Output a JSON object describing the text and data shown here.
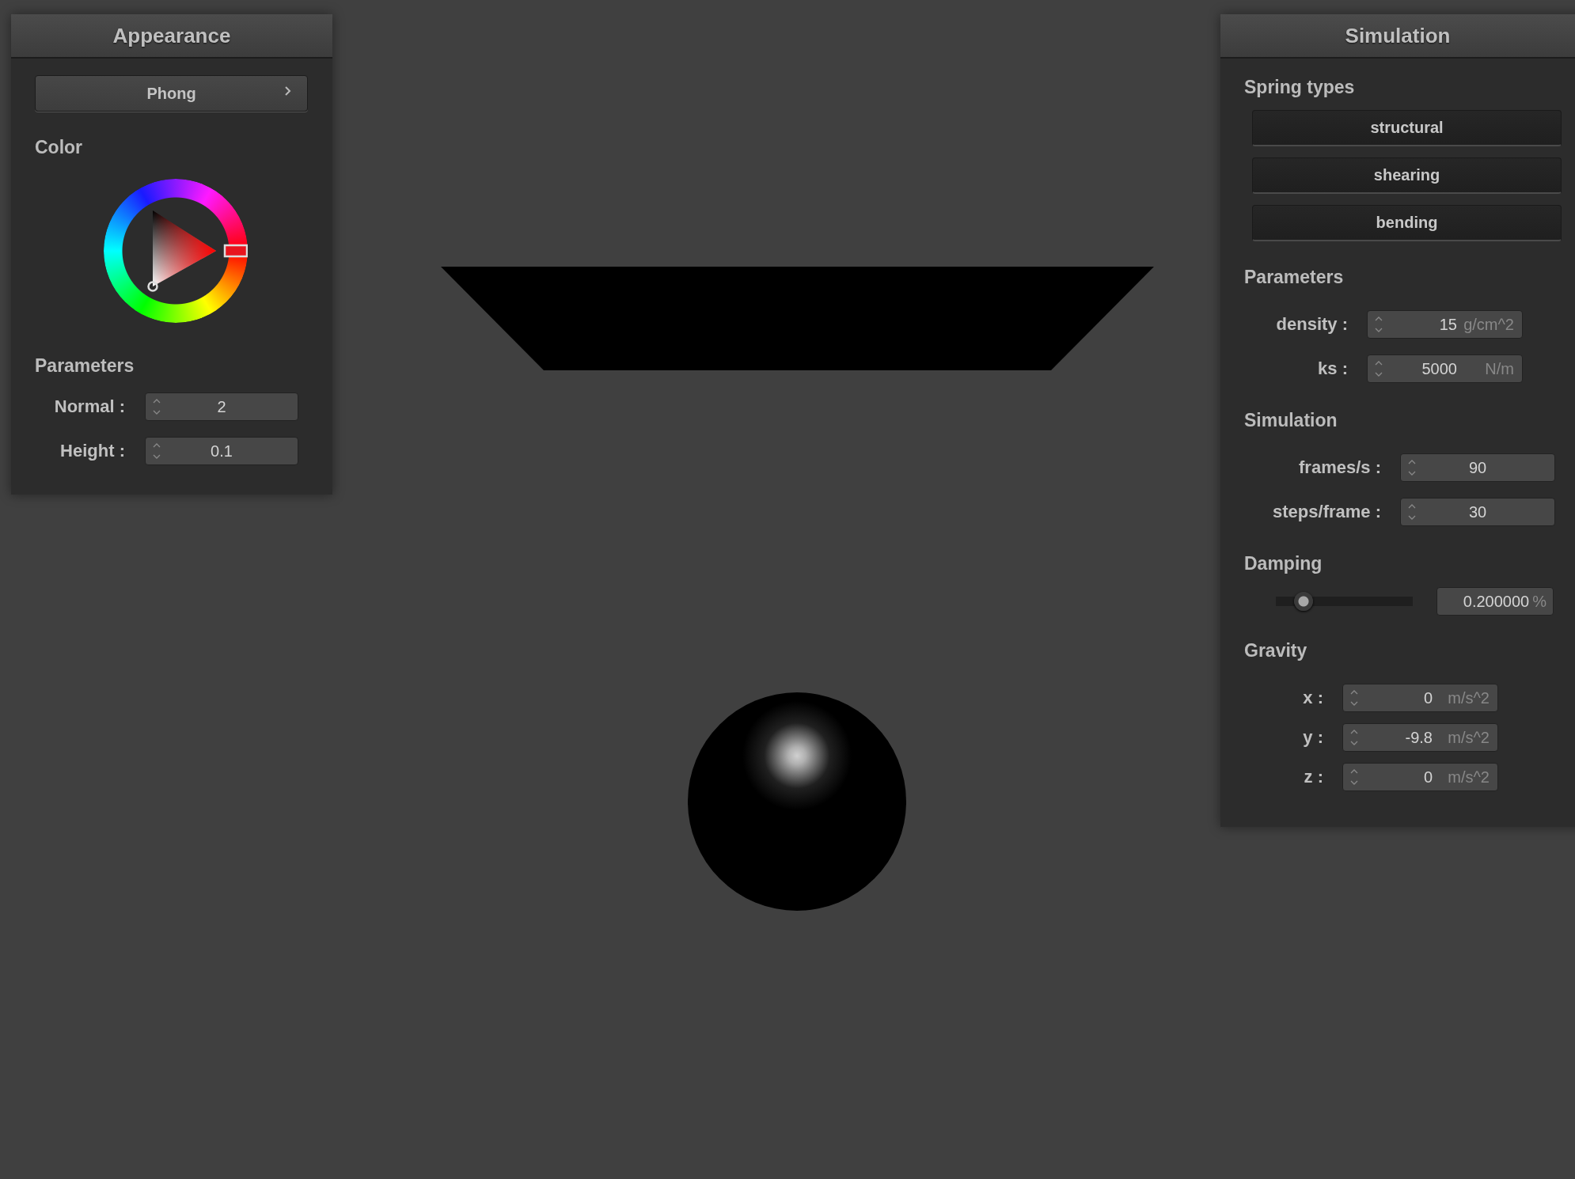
{
  "appearance_panel": {
    "title": "Appearance",
    "shader_select": "Phong",
    "color_label": "Color",
    "parameters_label": "Parameters",
    "fields": [
      {
        "label": "Normal :",
        "value": "2"
      },
      {
        "label": "Height :",
        "value": "0.1"
      }
    ]
  },
  "simulation_panel": {
    "title": "Simulation",
    "sections": [
      {
        "kind": "buttons",
        "heading": "Spring types",
        "buttons": [
          "structural",
          "shearing",
          "bending"
        ]
      },
      {
        "kind": "fields",
        "heading": "Parameters",
        "fields": [
          {
            "label": "density :",
            "value": "15",
            "unit": "g/cm^2"
          },
          {
            "label": "ks :",
            "value": "5000",
            "unit": "N/m"
          }
        ]
      },
      {
        "kind": "fields",
        "heading": "Simulation",
        "fields": [
          {
            "label": "frames/s :",
            "value": "90"
          },
          {
            "label": "steps/frame :",
            "value": "30"
          }
        ]
      },
      {
        "kind": "slider",
        "heading": "Damping",
        "level": 0.2,
        "value": "0.200000",
        "unit": "%"
      },
      {
        "kind": "fields",
        "heading": "Gravity",
        "fields": [
          {
            "label": "x :",
            "value": "0",
            "unit": "m/s^2"
          },
          {
            "label": "y :",
            "value": "-9.8",
            "unit": "m/s^2"
          },
          {
            "label": "z :",
            "value": "0",
            "unit": "m/s^2"
          }
        ]
      }
    ]
  }
}
